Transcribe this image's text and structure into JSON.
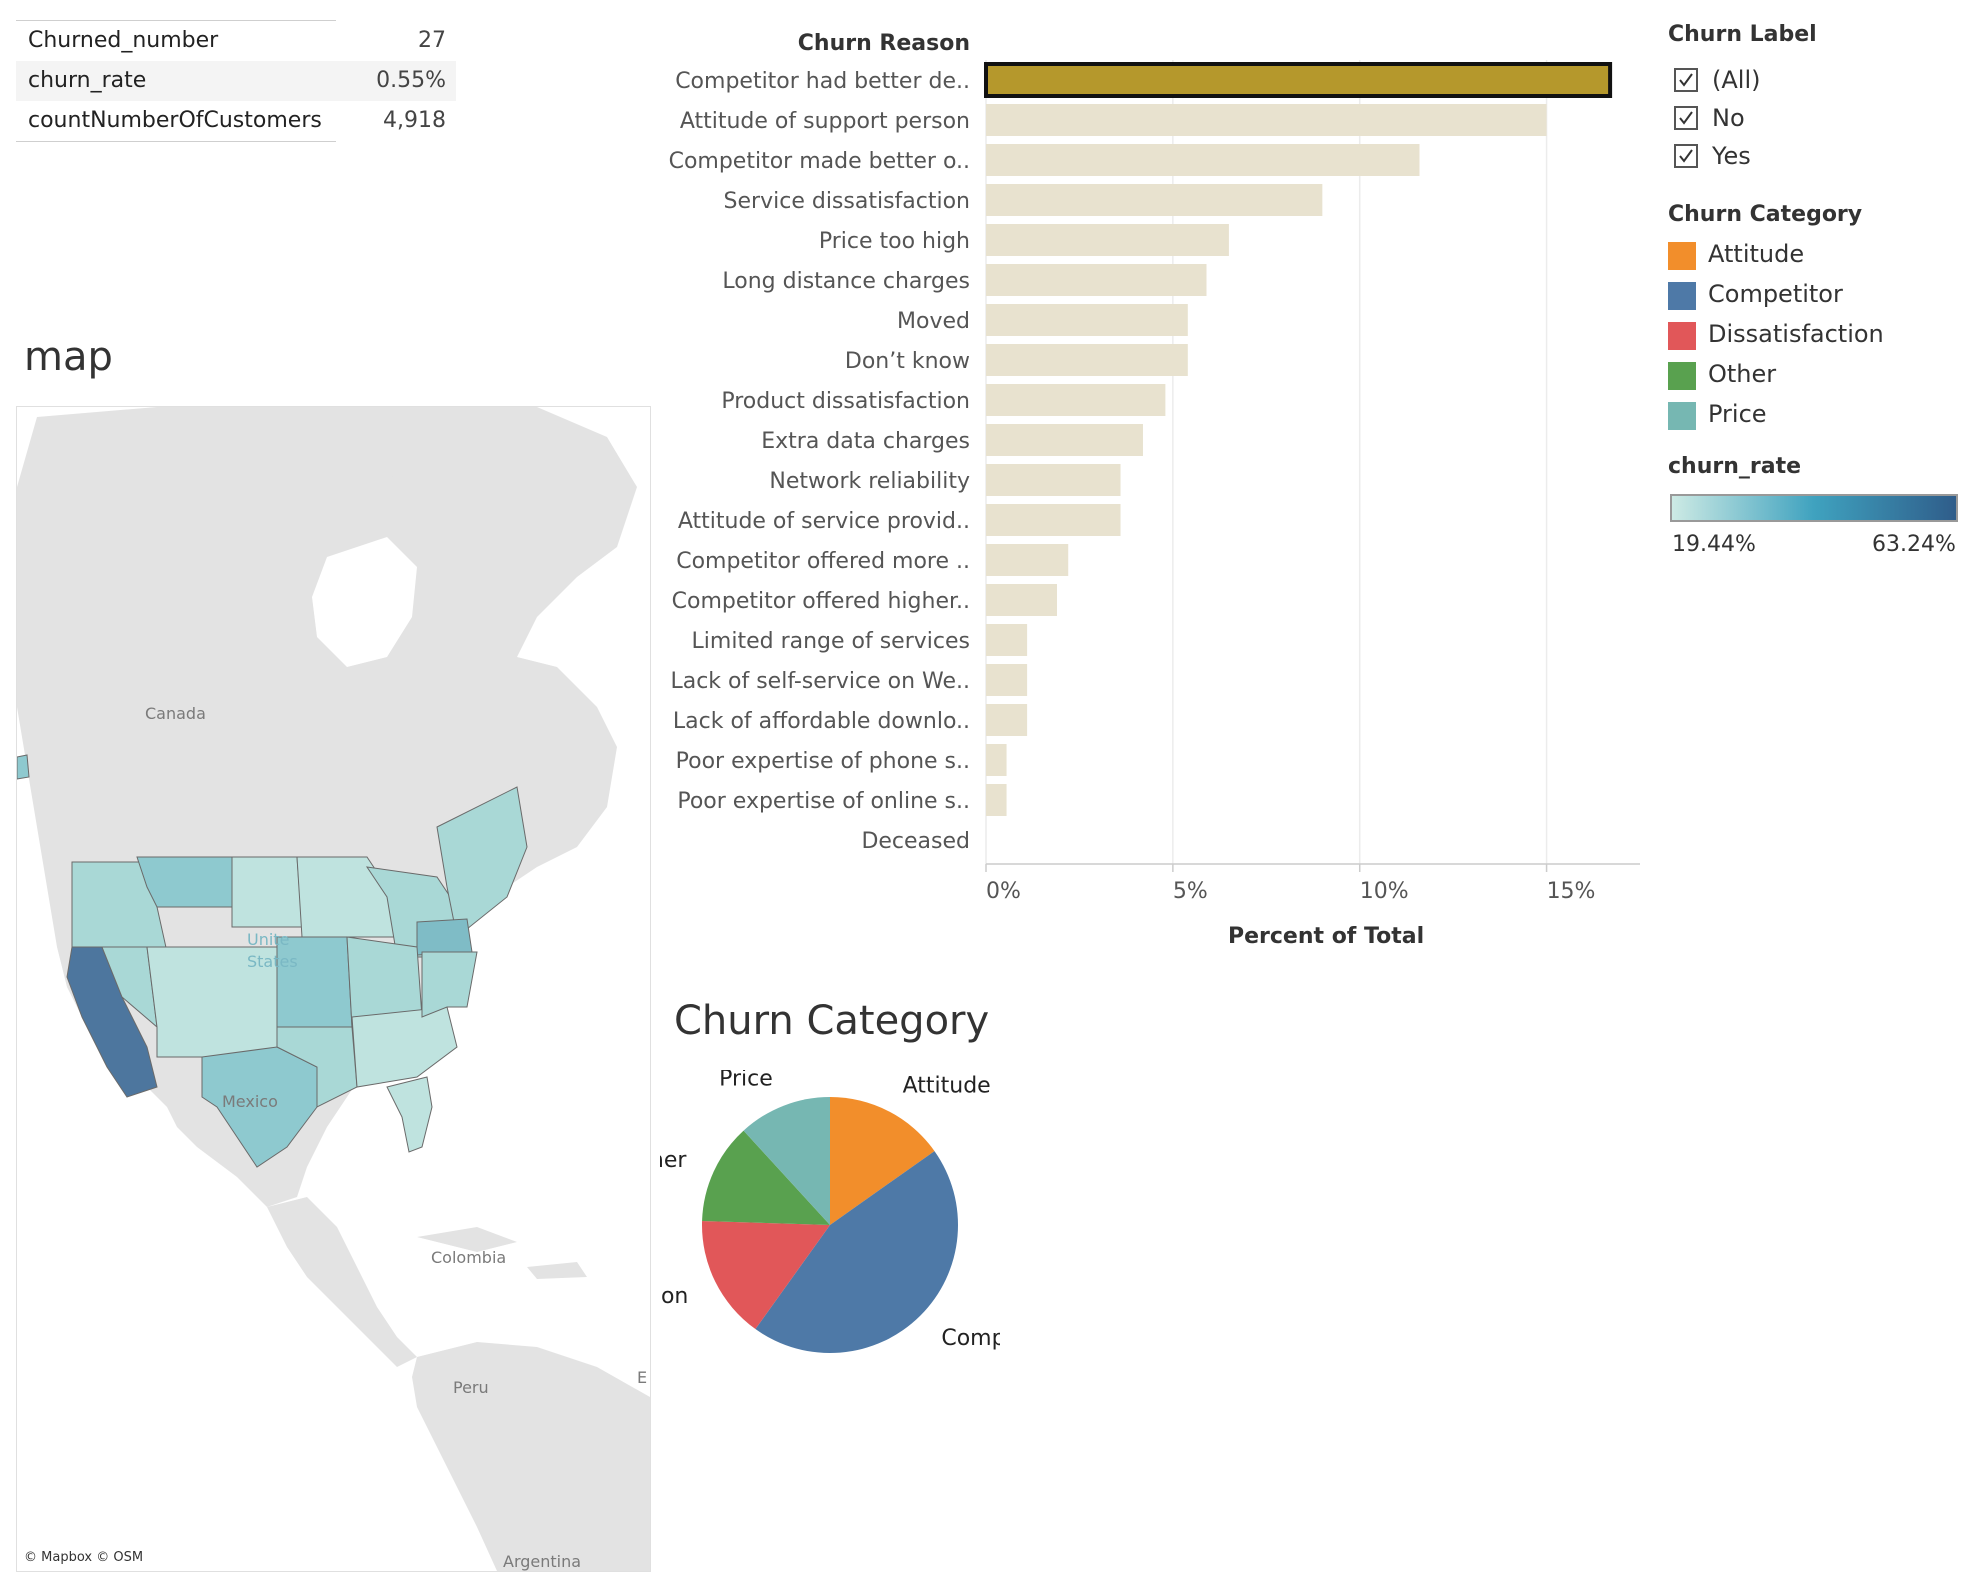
{
  "kpi": [
    {
      "label": "Churned_number",
      "value": "27"
    },
    {
      "label": "churn_rate",
      "value": "0.55%"
    },
    {
      "label": "countNumberOfCustomers",
      "value": "4,918"
    }
  ],
  "map": {
    "title": "map",
    "labels": {
      "canada": "Canada",
      "us_line1": "Unite",
      "us_line2": "States",
      "mexico": "Mexico",
      "colombia": "Colombia",
      "peru": "Peru",
      "argentina": "Argentina",
      "edge": "E"
    },
    "credit": "© Mapbox © OSM",
    "colors": {
      "land": "#e3e3e3",
      "water": "#ffffff",
      "state_light": "#bfe3df",
      "state_mid": "#8ec9cf",
      "state_dark": "#4d769e",
      "border": "#6a6a6a"
    }
  },
  "chart_data": [
    {
      "type": "bar",
      "orientation": "horizontal",
      "header": "Churn Reason",
      "xlabel": "Percent of Total",
      "categories": [
        "Competitor had better de..",
        "Attitude of support person",
        "Competitor made better o..",
        "Service dissatisfaction",
        "Price too high",
        "Long distance charges",
        "Moved",
        "Don’t know",
        "Product dissatisfaction",
        "Extra data charges",
        "Network reliability",
        "Attitude of service provid..",
        "Competitor offered more ..",
        "Competitor offered higher..",
        "Limited range of services",
        "Lack of self-service on We..",
        "Lack of affordable downlo..",
        "Poor expertise of phone s..",
        "Poor expertise of online s..",
        "Deceased"
      ],
      "values": [
        16.7,
        15.0,
        11.6,
        9.0,
        6.5,
        5.9,
        5.4,
        5.4,
        4.8,
        4.2,
        3.6,
        3.6,
        2.2,
        1.9,
        1.1,
        1.1,
        1.1,
        0.55,
        0.55,
        0.0
      ],
      "xlim": [
        0,
        17.5
      ],
      "xticks": [
        "0%",
        "5%",
        "10%",
        "15%"
      ],
      "xtick_values": [
        0,
        5,
        10,
        15
      ],
      "highlighted_index": 0,
      "colors": {
        "bar": "#e8e2cf",
        "highlight": "#b5982c",
        "highlight_border": "#111111",
        "grid": "#ececec"
      }
    },
    {
      "type": "pie",
      "title": "Churn Category",
      "slices": [
        {
          "label": "Attitude",
          "value": 15.2,
          "color": "#f28e2b"
        },
        {
          "label": "Competitor",
          "value": 44.7,
          "color": "#4e79a7"
        },
        {
          "label": "Dissatisfaction",
          "value": 15.6,
          "color": "#e15759"
        },
        {
          "label": "Other",
          "value": 12.7,
          "color": "#59a14f"
        },
        {
          "label": "Price",
          "value": 11.8,
          "color": "#76b7b2"
        }
      ]
    }
  ],
  "legend": {
    "churn_label": {
      "title": "Churn Label",
      "items": [
        {
          "label": "(All)",
          "checked": true
        },
        {
          "label": "No",
          "checked": true
        },
        {
          "label": "Yes",
          "checked": true
        }
      ]
    },
    "churn_category": {
      "title": "Churn Category",
      "items": [
        {
          "label": "Attitude",
          "color": "#f28e2b"
        },
        {
          "label": "Competitor",
          "color": "#4e79a7"
        },
        {
          "label": "Dissatisfaction",
          "color": "#e15759"
        },
        {
          "label": "Other",
          "color": "#59a14f"
        },
        {
          "label": "Price",
          "color": "#76b7b2"
        }
      ]
    },
    "churn_rate": {
      "title": "churn_rate",
      "min": "19.44%",
      "max": "63.24%",
      "colors": [
        "#cdeae4",
        "#3fa2bf",
        "#2f5d8a"
      ]
    }
  }
}
